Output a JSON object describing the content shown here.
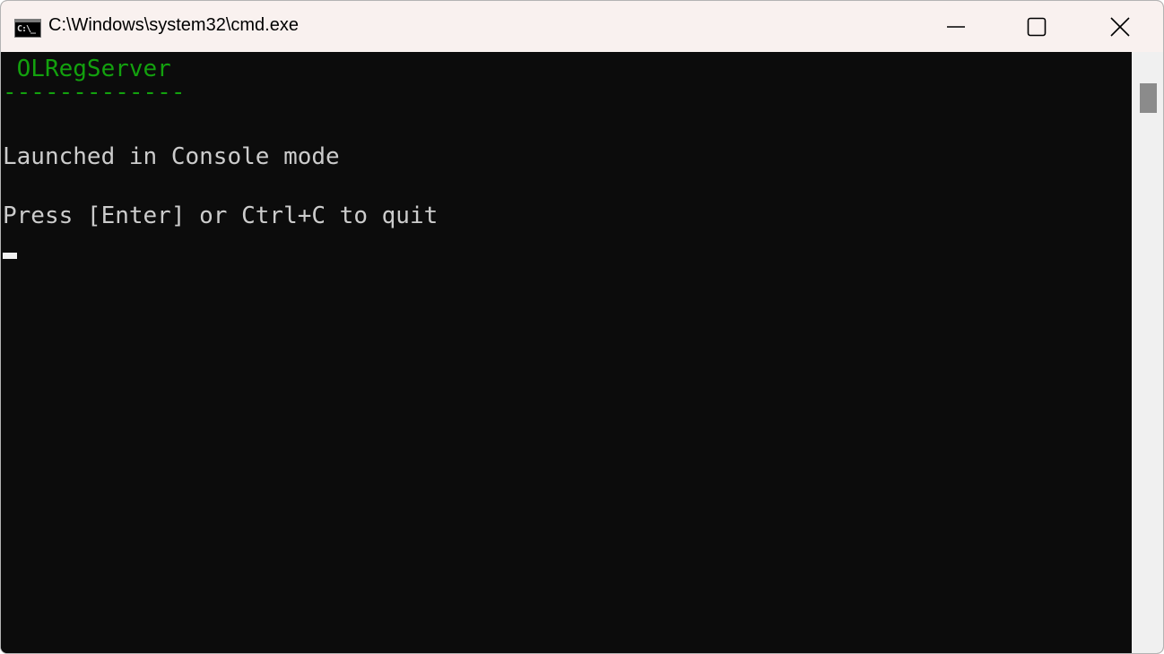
{
  "window": {
    "title": "C:\\Windows\\system32\\cmd.exe",
    "icon": "cmd-icon",
    "icon_text": "C:\\_",
    "controls": {
      "minimize": "minimize-icon",
      "maximize": "maximize-icon",
      "close": "close-icon"
    }
  },
  "console": {
    "lines": [
      " OLRegServer",
      "-------------",
      "",
      "Launched in Console mode",
      "",
      "Press [Enter] or Ctrl+C to quit"
    ]
  },
  "colors": {
    "title_bg": "#f9f1ef",
    "console_bg": "#0c0c0c",
    "console_fg": "#cccccc",
    "accent_green": "#13a10e"
  }
}
